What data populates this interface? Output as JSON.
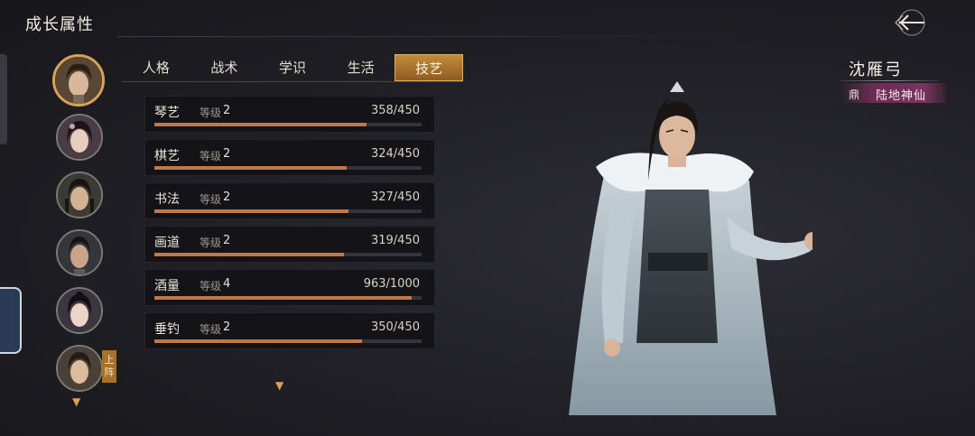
{
  "header": {
    "title": "成长属性"
  },
  "tabs": [
    {
      "label": "人格",
      "active": false
    },
    {
      "label": "战术",
      "active": false
    },
    {
      "label": "学识",
      "active": false
    },
    {
      "label": "生活",
      "active": false
    },
    {
      "label": "技艺",
      "active": true
    }
  ],
  "skills": [
    {
      "name": "琴艺",
      "level_prefix": "等级",
      "level": "2",
      "value": "358/450",
      "progress": 0.7956
    },
    {
      "name": "棋艺",
      "level_prefix": "等级",
      "level": "2",
      "value": "324/450",
      "progress": 0.72
    },
    {
      "name": "书法",
      "level_prefix": "等级",
      "level": "2",
      "value": "327/450",
      "progress": 0.7267
    },
    {
      "name": "画道",
      "level_prefix": "等级",
      "level": "2",
      "value": "319/450",
      "progress": 0.7089
    },
    {
      "name": "酒量",
      "level_prefix": "等级",
      "level": "4",
      "value": "963/1000",
      "progress": 0.963
    },
    {
      "name": "垂钓",
      "level_prefix": "等级",
      "level": "2",
      "value": "350/450",
      "progress": 0.7778
    }
  ],
  "roster": {
    "deploy_tag": "上阵",
    "avatars": [
      "avatar-hero-selected",
      "avatar-female-1",
      "avatar-male-2",
      "avatar-male-3",
      "avatar-female-4",
      "avatar-male-5"
    ]
  },
  "character": {
    "name": "沈雁弓",
    "realm": "陆地神仙",
    "realm_icon": "鼎"
  },
  "icons": {
    "back": "back-arrow-icon",
    "scroll_down": "chevron-down-icon"
  },
  "colors": {
    "accent": "#d9a25a",
    "tab_active": "#b07a32",
    "bar_fill": "#c07a4a",
    "realm_banner": "#6a2c52"
  }
}
